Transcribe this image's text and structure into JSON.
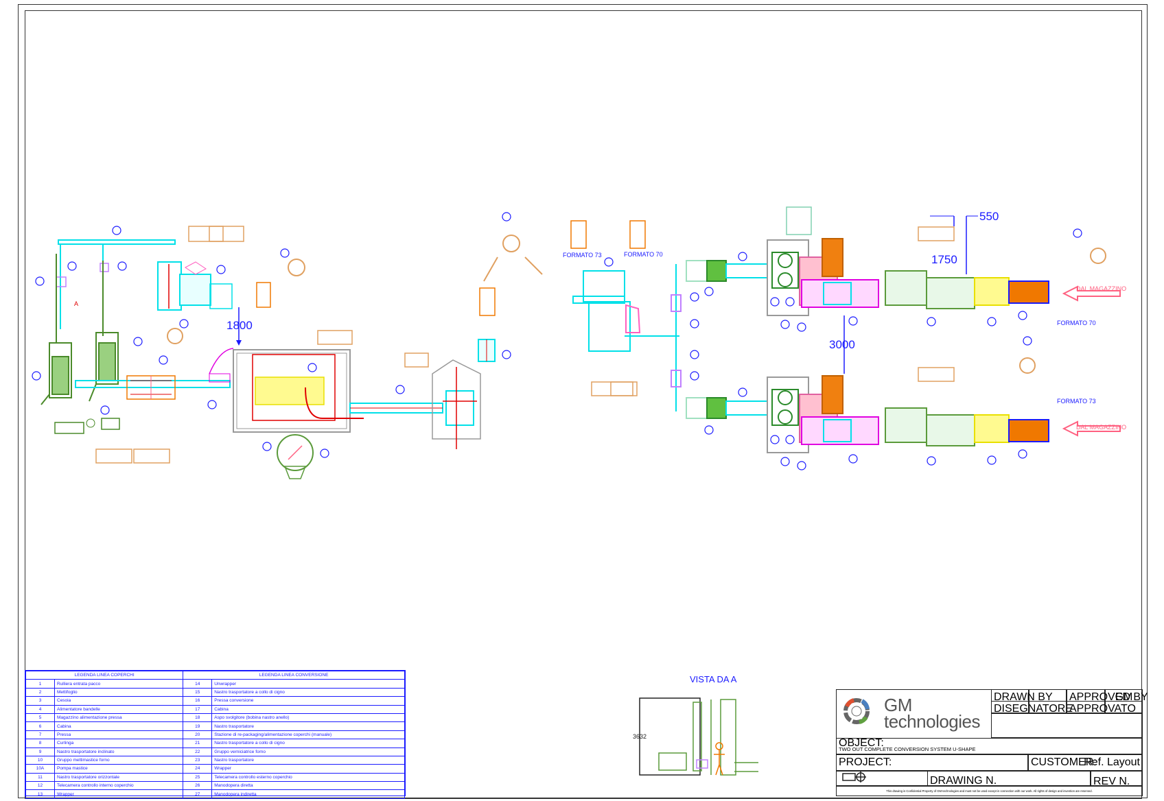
{
  "labels": {
    "formato_73_top": "FORMATO 73",
    "formato_70_top": "FORMATO 70",
    "formato_70_right": "FORMATO 70",
    "formato_73_right": "FORMATO 73",
    "dal_magazzino_1": "DAL MAGAZZINO",
    "dal_magazzino_2": "DAL MAGAZZINO",
    "dim_1800": "1800",
    "dim_3000": "3000",
    "dim_1750": "1750",
    "dim_550": "550",
    "vista_da_a": "VISTA DA A",
    "vista_dim": "3632",
    "arrow_a": "A"
  },
  "legend": {
    "left_title": "LEGENDA LINEA COPERCHI",
    "right_title": "LEGENDA LINEA CONVERSIONE",
    "rows": [
      {
        "n1": "1",
        "t1": "Rulliera entrata pacco",
        "n2": "14",
        "t2": "Unwrapper"
      },
      {
        "n1": "2",
        "t1": "Mettifoglio",
        "n2": "15",
        "t2": "Nastro trasportatore a collo di cigno"
      },
      {
        "n1": "3",
        "t1": "Cesoia",
        "n2": "16",
        "t2": "Pressa conversione"
      },
      {
        "n1": "4",
        "t1": "Alimentatore bandelle",
        "n2": "17",
        "t2": "Cabina"
      },
      {
        "n1": "5",
        "t1": "Magazzino alimentazione pressa",
        "n2": "18",
        "t2": "Aspo svolgitore (bobina nastro anello)"
      },
      {
        "n1": "6",
        "t1": "Cabina",
        "n2": "19",
        "t2": "Nastro trasportatore"
      },
      {
        "n1": "7",
        "t1": "Pressa",
        "n2": "20",
        "t2": "Stazione di re-packaging/alimentazione coperchi (manuale)"
      },
      {
        "n1": "8",
        "t1": "Curlinga",
        "n2": "21",
        "t2": "Nastro trasportatore a collo di cigno"
      },
      {
        "n1": "9",
        "t1": "Nastro trasportatore inclinato",
        "n2": "22",
        "t2": "Gruppo verniciatrice forno"
      },
      {
        "n1": "10",
        "t1": "Gruppo mettimastice forno",
        "n2": "23",
        "t2": "Nastro trasportatore"
      },
      {
        "n1": "10A",
        "t1": "Pompa mastice",
        "n2": "24",
        "t2": "Wrapper"
      },
      {
        "n1": "11",
        "t1": "Nastro trasportatore orizzontale",
        "n2": "25",
        "t2": "Telecamera controllo esterno coperchio"
      },
      {
        "n1": "12",
        "t1": "Telecamera controllo interno coperchio",
        "n2": "26",
        "t2": "Manodopera diretta"
      },
      {
        "n1": "13",
        "t1": "Wrapper",
        "n2": "27",
        "t2": "Manodopera indiretta"
      }
    ]
  },
  "title_block": {
    "brand_line1": "GM",
    "brand_line2": "technologies",
    "drawn_by": "DRAWN BY",
    "disegnatore": "DISEGNATORE",
    "approved_by": "APPROVED BY",
    "approvato": "APPROVATO",
    "approved_value": "GM",
    "object_label": "OBJECT:",
    "object_value": "TWO OUT COMPLETE CONVERSION SYSTEM U-SHAPE",
    "project_label": "PROJECT:",
    "customer_label": "CUSTOMER:",
    "ref_label": "Ref. Layout",
    "drawing_label": "DRAWING N.",
    "rev_label": "REV N.",
    "footer": "This drawing is Confidential Property of GM-technologies and must not be used except in connection with our work. All rights of design and invention are reserved."
  },
  "colors": {
    "blue_text": "#1a1aff",
    "cyan": "#00e0e8",
    "green": "#5a9a3a",
    "magenta": "#e000e0",
    "yellow": "#f0f000",
    "orange": "#f07800",
    "tan": "#e0a060",
    "red": "#e00000",
    "pink": "#ff6080"
  }
}
